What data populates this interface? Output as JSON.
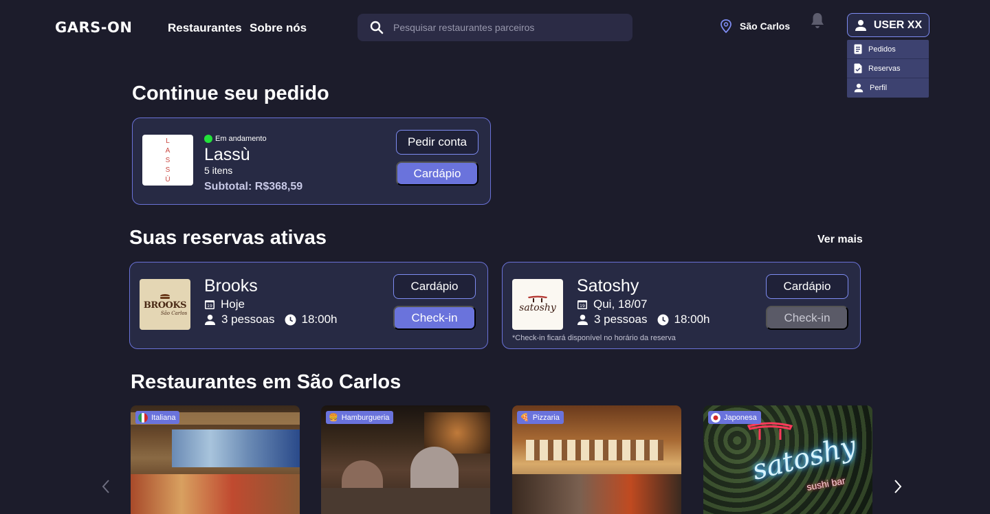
{
  "header": {
    "logo": "GARS-ON",
    "nav": [
      "Restaurantes",
      "Sobre nós"
    ],
    "search_placeholder": "Pesquisar restaurantes parceiros",
    "location": "São Carlos",
    "user_label": "USER XX",
    "user_menu": [
      "Pedidos",
      "Reservas",
      "Perfil"
    ]
  },
  "order_section": {
    "title": "Continue seu pedido",
    "logo_letters": [
      "L",
      "A",
      "S",
      "S",
      "Ù"
    ],
    "status": "Em andamento",
    "restaurant": "Lassù",
    "items": "5 itens",
    "subtotal": "Subtotal: R$368,59",
    "btn_account": "Pedir conta",
    "btn_menu": "Cardápio"
  },
  "reservations_section": {
    "title": "Suas reservas ativas",
    "see_more": "Ver mais",
    "reservations": [
      {
        "name": "Brooks",
        "logo_text": "BROOKS",
        "logo_sub": "São Carlos",
        "day": "Hoje",
        "people": "3 pessoas",
        "time": "18:00h",
        "btn_menu": "Cardápio",
        "btn_checkin": "Check-in",
        "note": ""
      },
      {
        "name": "Satoshy",
        "logo_text": "satoshy",
        "day": "Qui, 18/07",
        "people": "3 pessoas",
        "time": "18:00h",
        "btn_menu": "Cardápio",
        "btn_checkin": "Check-in",
        "note": "*Check-in ficará disponível no horário da reserva"
      }
    ]
  },
  "restaurants_section": {
    "title": "Restaurantes em São Carlos",
    "cards": [
      {
        "tag": "Italiana"
      },
      {
        "tag": "Hamburgueria"
      },
      {
        "tag": "Pizzaria"
      },
      {
        "tag": "Japonesa",
        "sign": "satoshy",
        "sign_sub": "sushi bar"
      }
    ]
  },
  "colors": {
    "background": "#1c1c2b",
    "card": "#272a44",
    "accent": "#6a73dc",
    "status_dot": "#22e23a"
  },
  "icons": {
    "search": "search-icon",
    "location": "map-pin-icon",
    "notification": "bell-icon",
    "user": "user-icon",
    "calendar": "calendar-icon",
    "clock": "clock-icon",
    "prev": "chevron-left-icon",
    "next": "chevron-right-icon"
  }
}
